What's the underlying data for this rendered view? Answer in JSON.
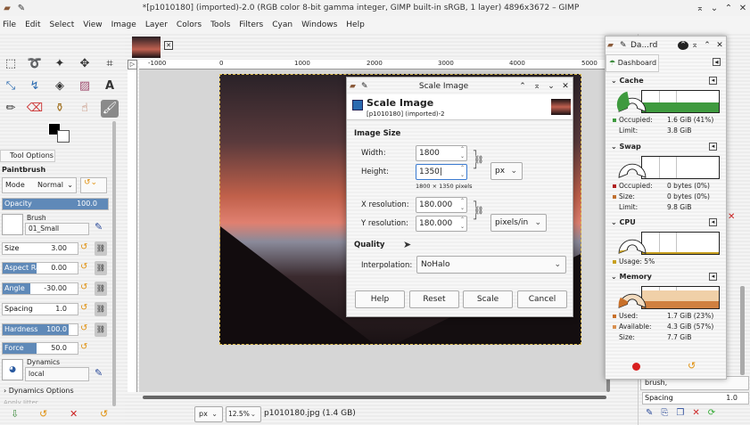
{
  "window": {
    "title": "*[p1010180] (imported)-2.0 (RGB color 8-bit gamma integer, GIMP built-in sRGB, 1 layer) 4896x3672 – GIMP"
  },
  "menu": [
    "File",
    "Edit",
    "Select",
    "View",
    "Image",
    "Layer",
    "Colors",
    "Tools",
    "Filters",
    "Cyan",
    "Windows",
    "Help"
  ],
  "tool_options": {
    "tab": "Tool Options",
    "tool": "Paintbrush",
    "mode_label": "Mode",
    "mode_value": "Normal",
    "opacity_label": "Opacity",
    "opacity": "100.0",
    "brush_label": "Brush",
    "brush": "01_Small",
    "size_label": "Size",
    "size": "3.00",
    "aspect_label": "Aspect Ratio",
    "aspect": "0.00",
    "angle_label": "Angle",
    "angle": "-30.00",
    "spacing_label": "Spacing",
    "spacing": "1.0",
    "hardness_label": "Hardness",
    "hardness": "100.0",
    "force_label": "Force",
    "force": "50.0",
    "dynamics_label": "Dynamics",
    "dynamics": "local",
    "dynamics_options": "Dynamics Options",
    "apply_jitter": "Apply Jitter"
  },
  "ruler": [
    "-1000",
    "0",
    "1000",
    "2000",
    "3000",
    "4000",
    "5000"
  ],
  "status": {
    "unit": "px",
    "zoom": "12.5%",
    "file": "p1010180.jpg (1.4 GB)"
  },
  "dashboard": {
    "title": "Da...rd",
    "tab": "Dashboard",
    "cache": {
      "title": "Cache",
      "occupied_label": "Occupied:",
      "occupied": "1.6 GiB (41%)",
      "limit_label": "Limit:",
      "limit": "3.8 GiB",
      "fraction": 0.41
    },
    "swap": {
      "title": "Swap",
      "occupied_label": "Occupied:",
      "occupied": "0 bytes (0%)",
      "size_label": "Size:",
      "size": "0 bytes (0%)",
      "limit_label": "Limit:",
      "limit": "9.8 GiB"
    },
    "cpu": {
      "title": "CPU",
      "usage_label": "Usage:",
      "usage": "5%"
    },
    "memory": {
      "title": "Memory",
      "used_label": "Used:",
      "used": "1.7 GiB (23%)",
      "available_label": "Available:",
      "available": "4.3 GiB (57%)",
      "size_label": "Size:",
      "size": "7.7 GiB"
    }
  },
  "dock": {
    "brush": "brush,",
    "spacing_label": "Spacing",
    "spacing": "1.0"
  },
  "dialog": {
    "window_title": "Scale Image",
    "heading": "Scale Image",
    "subtitle": "[p1010180] (imported)-2",
    "image_size": "Image Size",
    "width_label": "Width:",
    "width": "1800",
    "height_label": "Height:",
    "height": "1350",
    "unit": "px",
    "pixels_note": "1800 × 1350 pixels",
    "xres_label": "X resolution:",
    "xres": "180.000",
    "yres_label": "Y resolution:",
    "yres": "180.000",
    "res_unit": "pixels/in",
    "quality": "Quality",
    "interp_label": "Interpolation:",
    "interp": "NoHalo",
    "help": "Help",
    "reset": "Reset",
    "scale": "Scale",
    "cancel": "Cancel"
  }
}
